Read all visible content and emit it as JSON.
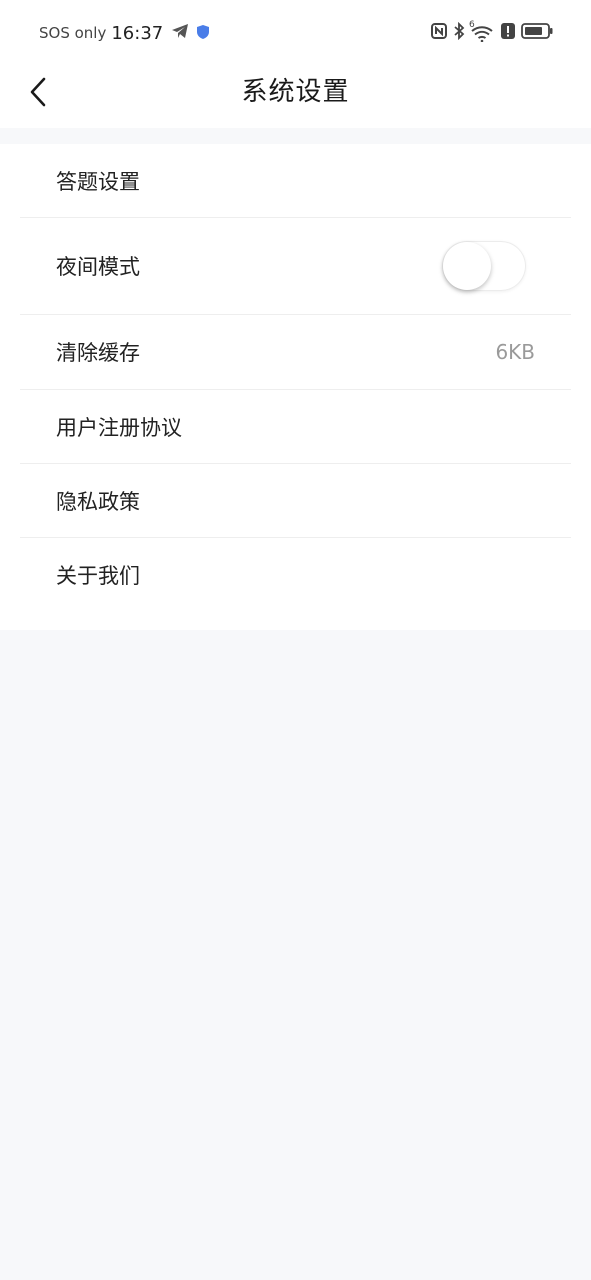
{
  "status_bar": {
    "sos_text": "SOS only",
    "time": "16:37",
    "icons": [
      "telegram-icon",
      "shield-icon",
      "nfc-icon",
      "bluetooth-icon",
      "wifi-6-icon",
      "alert-icon",
      "battery-icon"
    ],
    "wifi_badge": "6"
  },
  "header": {
    "title": "系统设置",
    "back_icon": "chevron-left-icon"
  },
  "settings": {
    "items": [
      {
        "label": "答题设置"
      },
      {
        "label": "夜间模式",
        "toggle_on": false
      },
      {
        "label": "清除缓存",
        "value": "6KB"
      },
      {
        "label": "用户注册协议"
      },
      {
        "label": "隐私政策"
      },
      {
        "label": "关于我们"
      }
    ]
  },
  "colors": {
    "background": "#f7f8fa",
    "card": "#ffffff",
    "text_primary": "#222222",
    "text_secondary": "#9a9a9a",
    "divider": "#eeeeee",
    "shield_accent": "#4a7de8"
  }
}
